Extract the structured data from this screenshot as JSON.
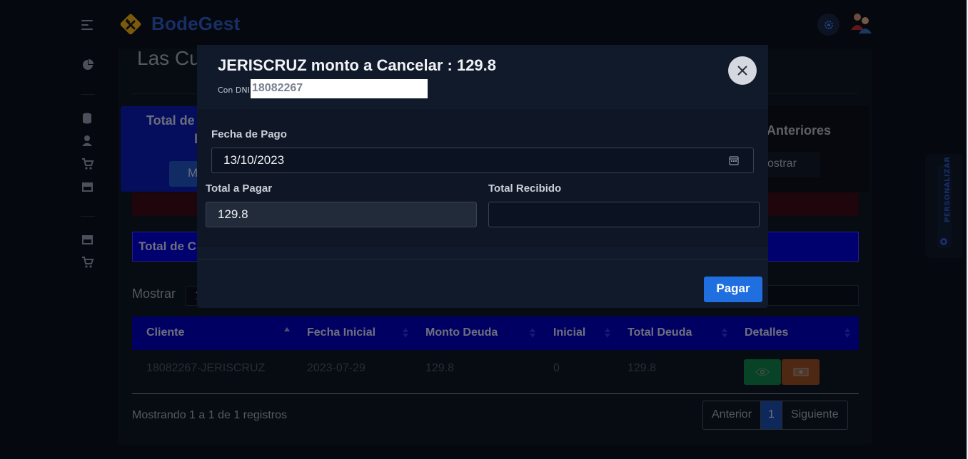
{
  "app": {
    "brand": "BodeGest"
  },
  "page": {
    "title": "Las Cu",
    "card_total": {
      "line1": "Total de",
      "line2": "l",
      "button": "M"
    },
    "card_anteriores": {
      "title": "Anteriores",
      "button": "ostrar"
    },
    "total_bar": "Total de C",
    "mostrar_label": "Mostrar",
    "mostrar_value": "1"
  },
  "table": {
    "headers": [
      "Cliente",
      "Fecha Inicial",
      "Monto Deuda",
      "Inicial",
      "Total Deuda",
      "Detalles"
    ],
    "rows": [
      {
        "cliente": "18082267-JERISCRUZ",
        "fecha": "2023-07-29",
        "monto": "129.8",
        "inicial": "0",
        "total": "129.8"
      }
    ],
    "info": "Mostrando 1 a 1 de 1 registros",
    "pagination": {
      "prev": "Anterior",
      "current": "1",
      "next": "Siguiente"
    }
  },
  "side_tab": {
    "label": "PERSONALIZAR"
  },
  "modal": {
    "title": "JERISCRUZ monto a Cancelar : 129.8",
    "dni_label": "Con DNI",
    "dni_value": "18082267",
    "fecha_label": "Fecha de Pago",
    "fecha_value": "13/10/2023",
    "total_pagar_label": "Total a Pagar",
    "total_pagar_value": "129.8",
    "total_recibido_label": "Total Recibido",
    "total_recibido_value": "",
    "pay_button": "Pagar"
  },
  "colors": {
    "brand": "#2a56b8",
    "table_header": "#0000b4",
    "pay_button": "#1f6fe0",
    "view_button": "#0f7a47",
    "money_button": "#8e4a24"
  },
  "icons": [
    "menu-icon",
    "logo-icon",
    "gear-icon",
    "avatar-icon",
    "chart-pie-icon",
    "database-icon",
    "user-icon",
    "cart-icon",
    "store-icon",
    "calendar-icon",
    "close-icon",
    "eye-icon",
    "money-icon"
  ]
}
